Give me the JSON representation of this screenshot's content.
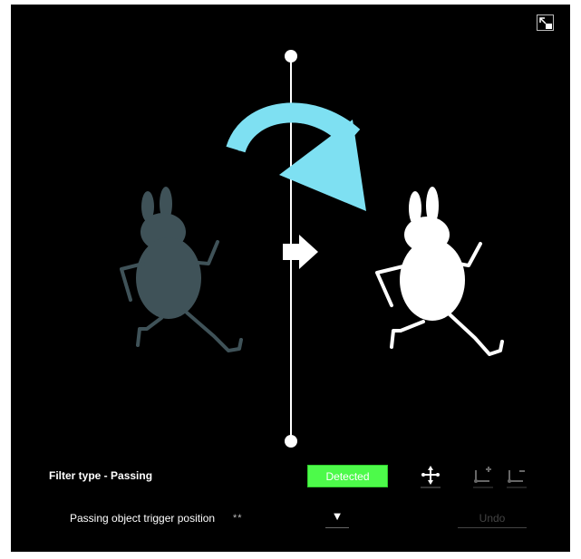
{
  "filter": {
    "type_label": "Filter type - Passing",
    "status_label": "Detected",
    "status_color": "#4dfa4a"
  },
  "trigger": {
    "label": "Passing object trigger position",
    "value": "**",
    "dropdown_glyph": "▼"
  },
  "actions": {
    "undo_label": "Undo"
  },
  "colors": {
    "background": "#000000",
    "arrow": "#7ee0f2",
    "figure_before": "#3f5258",
    "figure_after": "#ffffff"
  },
  "icons": {
    "expand": "expand-icon",
    "move_line": "move-line-icon",
    "add_point": "add-point-icon",
    "remove_point": "remove-point-icon"
  }
}
